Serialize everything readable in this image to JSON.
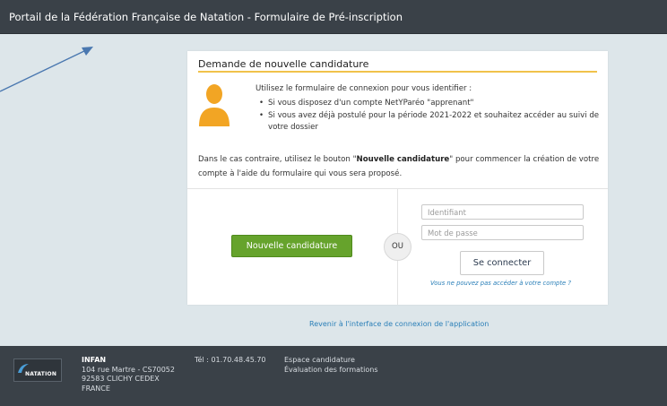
{
  "header": {
    "title": "Portail de la Fédération Française de Natation - Formulaire de Pré-inscription"
  },
  "colors": {
    "header_bg": "#3a4148",
    "page_bg": "#dde6ea",
    "accent_rule": "#f0c24b",
    "primary_button": "#66a32c",
    "link": "#2a7fb8"
  },
  "icons": {
    "avatar": "user-silhouette-icon",
    "annotation": "arrow-icon",
    "logo": "natation-wave-logo"
  },
  "card": {
    "title": "Demande de nouvelle candidature",
    "intro": "Utilisez le formulaire de connexion pour vous identifier :",
    "bullets": [
      "Si vous disposez d'un compte NetYParéo \"apprenant\"",
      "Si vous avez déjà postulé pour la période 2021-2022 et souhaitez accéder au suivi de",
      "votre dossier"
    ],
    "note_before": "Dans le cas contraire, utilisez le bouton \"",
    "note_bold": "Nouvelle candidature",
    "note_after": "\" pour commencer la création de votre compte à l'aide du formulaire qui vous sera proposé."
  },
  "actions": {
    "new_application": "Nouvelle candidature",
    "separator": "OU",
    "username_placeholder": "Identifiant",
    "password_placeholder": "Mot de passe",
    "username_value": "",
    "password_value": "",
    "connect": "Se connecter",
    "forgot": "Vous ne pouvez pas accéder à votre compte ?"
  },
  "back_link": "Revenir à l'interface de connexion de l'application",
  "footer": {
    "logo_text": "NATATION",
    "org_name": "INFAN",
    "address": [
      "104 rue Martre - CS70052",
      "92583 CLICHY CEDEX",
      "FRANCE"
    ],
    "phone": "Tél : 01.70.48.45.70",
    "links": [
      "Espace candidature",
      "Évaluation des formations"
    ]
  }
}
